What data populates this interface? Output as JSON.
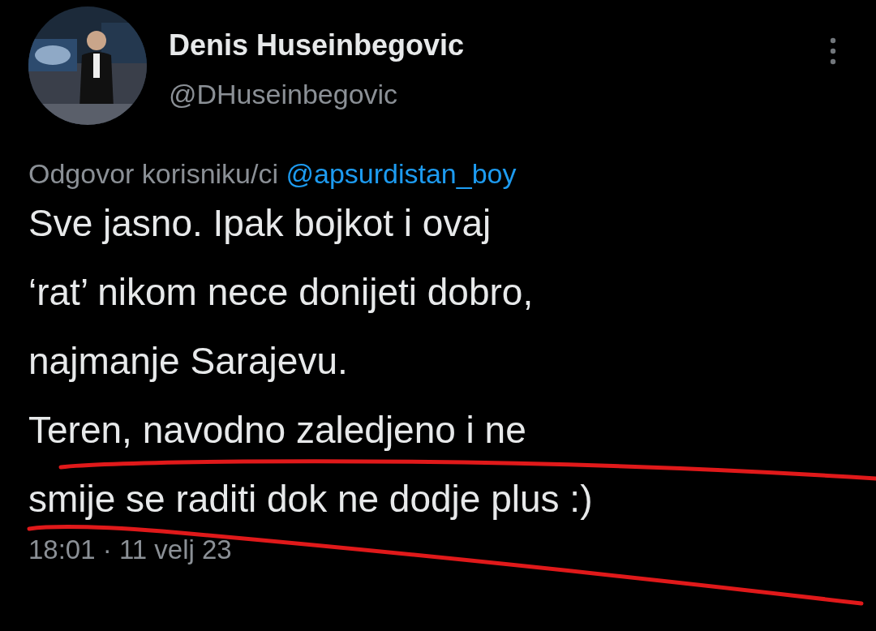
{
  "author": {
    "name": "Denis Huseinbegovic",
    "handle": "@DHuseinbegovic"
  },
  "reply_to": {
    "prefix": "Odgovor korisniku/ci",
    "mention": "@apsurdistan_boy"
  },
  "text_lines": [
    "Sve jasno. Ipak bojkot i ovaj",
    "‘rat’ nikom nece donijeti dobro,",
    "najmanje Sarajevu.",
    "Teren, navodno zaledjeno i ne",
    "smije se raditi dok ne dodje plus :)"
  ],
  "timestamp": "18:01 · 11 velj 23"
}
